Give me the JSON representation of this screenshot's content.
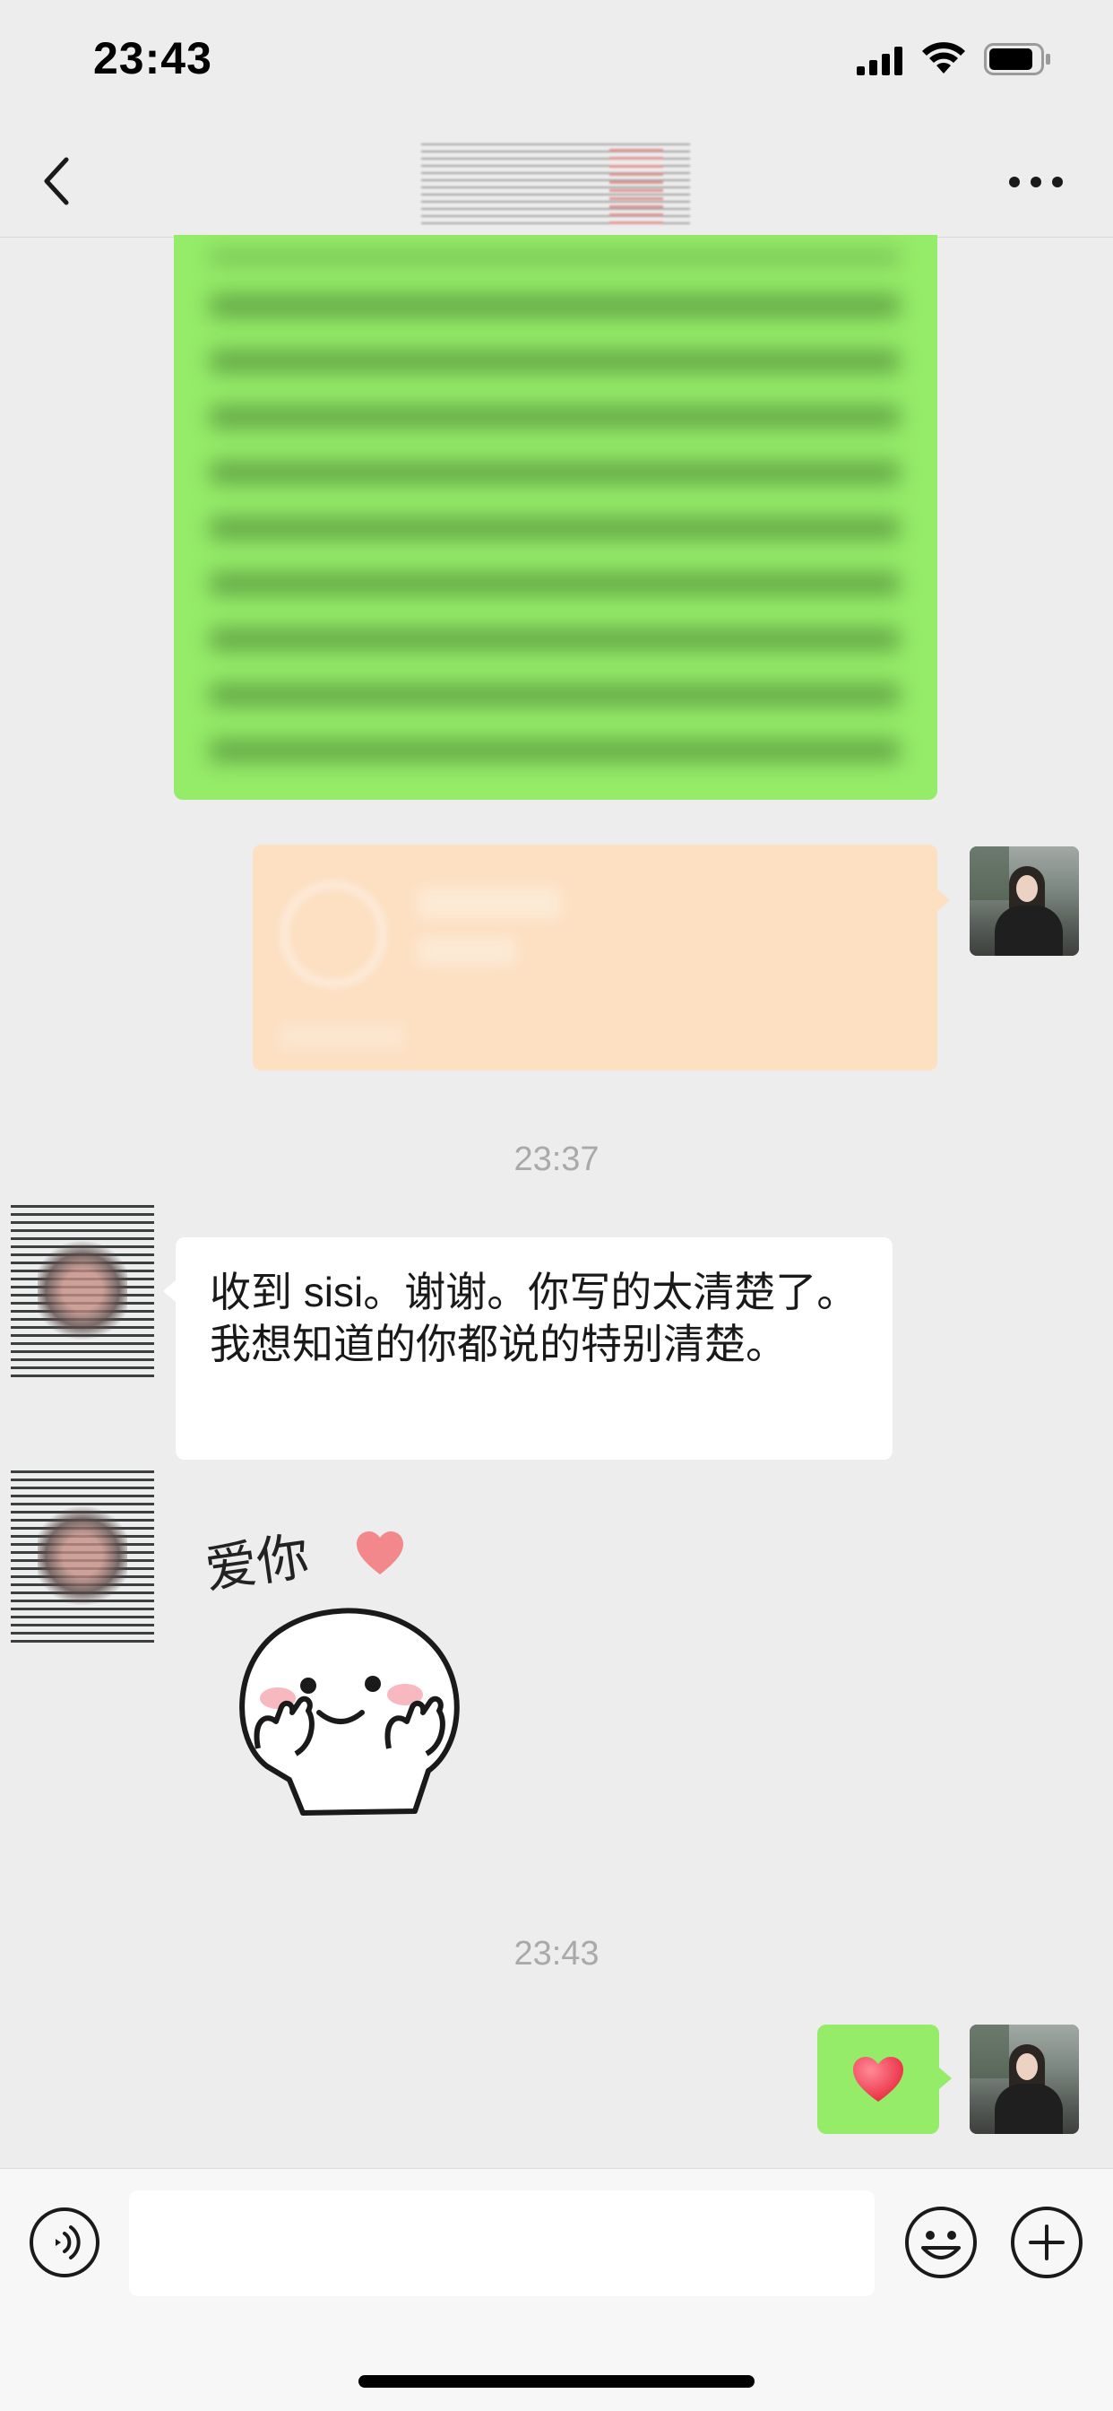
{
  "status_bar": {
    "time": "23:43"
  },
  "timestamps": {
    "first": "23:37",
    "second": "23:43"
  },
  "messages": {
    "incoming_text": "收到 sisi。谢谢。你写的太清楚了。我想知道的你都说的特别清楚。",
    "sticker_caption": "爱你"
  },
  "input": {
    "value": "",
    "placeholder": ""
  },
  "colors": {
    "background": "#ededed",
    "outgoing_bubble": "#95ec69",
    "incoming_bubble": "#ffffff",
    "transfer_card": "#fde0c2",
    "timestamp_text": "#a9a9a9"
  },
  "icons": {
    "back": "chevron-left-icon",
    "more": "more-dots-icon",
    "voice": "voice-icon",
    "emoji": "emoji-icon",
    "plus": "plus-icon",
    "heart": "heart-icon"
  }
}
